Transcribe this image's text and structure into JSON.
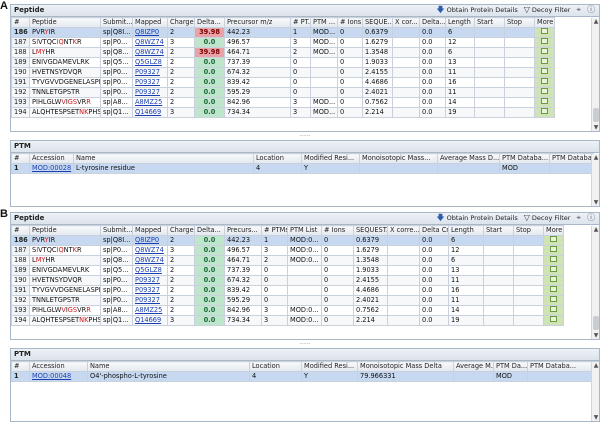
{
  "panelA": {
    "label": "A",
    "peptide": {
      "title": "Peptide",
      "obtain": "Obtain Protein Details",
      "decoy": "Decoy Filter",
      "headers": [
        "#",
        "Peptide",
        "Submit...",
        "Mapped",
        "Charge",
        "Delta...",
        "Precursor m/z",
        "# PT...",
        "PTM ...",
        "# Ions",
        "SEQUE...",
        "X cor...",
        "Delta...",
        "Length",
        "Start",
        "Stop",
        "More"
      ],
      "rows": [
        [
          "186",
          "PVRYIR",
          "sp|Q8I...",
          "Q8IZP0",
          "2",
          "39.98",
          "442.23",
          "1",
          "MOD...",
          "0",
          "0.6379",
          "",
          "0.0",
          "6",
          "",
          "",
          ""
        ],
        [
          "187",
          "SIVTQCIQNTKR",
          "sp|P0...",
          "Q8WZ74",
          "3",
          "0.0",
          "496.57",
          "3",
          "MOD...",
          "0",
          "1.6279",
          "",
          "0.0",
          "12",
          "",
          "",
          ""
        ],
        [
          "188",
          "LMYHR",
          "sp|Q8...",
          "Q8WZ74",
          "2",
          "39.98",
          "464.71",
          "2",
          "MOD...",
          "0",
          "1.3548",
          "",
          "0.0",
          "6",
          "",
          "",
          ""
        ],
        [
          "189",
          "ENIVGDAMEVLRK",
          "sp|Q5...",
          "Q5GLZ8",
          "2",
          "0.0",
          "737.39",
          "0",
          "",
          "0",
          "1.9033",
          "",
          "0.0",
          "13",
          "",
          "",
          ""
        ],
        [
          "190",
          "HVETNSYDVQR",
          "sp|P0...",
          "P09327",
          "2",
          "0.0",
          "674.32",
          "0",
          "",
          "0",
          "2.4155",
          "",
          "0.0",
          "11",
          "",
          "",
          ""
        ],
        [
          "191",
          "TYVGVVDGENELASPK",
          "sp|P0...",
          "P09327",
          "2",
          "0.0",
          "839.42",
          "0",
          "",
          "0",
          "4.4686",
          "",
          "0.0",
          "16",
          "",
          "",
          ""
        ],
        [
          "192",
          "TNNLETGPSTR",
          "sp|P0...",
          "P09327",
          "2",
          "0.0",
          "595.29",
          "0",
          "",
          "0",
          "2.4021",
          "",
          "0.0",
          "11",
          "",
          "",
          ""
        ],
        [
          "193",
          "PIHLGLWVIGSVRR",
          "sp|A8...",
          "A8MZ25",
          "2",
          "0.0",
          "842.96",
          "3",
          "MOD...",
          "0",
          "0.7562",
          "",
          "0.0",
          "14",
          "",
          "",
          ""
        ],
        [
          "194",
          "ALQHTESPSETNKPHSKS",
          "sp|Q1...",
          "Q14669",
          "3",
          "0.0",
          "734.34",
          "3",
          "MOD...",
          "0",
          "2.214",
          "",
          "0.0",
          "19",
          "",
          "",
          ""
        ]
      ]
    },
    "ptm": {
      "title": "PTM",
      "headers": [
        "#",
        "Accession",
        "Name",
        "Location",
        "Modified Resi...",
        "Monoisotopic Mass...",
        "Average Mass D...",
        "PTM Databa...",
        "PTM Database Ver..."
      ],
      "rows": [
        [
          "1",
          "MOD:00028",
          "L-tyrosine residue",
          "4",
          "Y",
          "",
          "",
          "MOD",
          ""
        ]
      ]
    }
  },
  "panelB": {
    "label": "B",
    "peptide": {
      "title": "Peptide",
      "obtain": "Obtain Protein Details",
      "decoy": "Decoy Filter",
      "headers": [
        "#",
        "Peptide",
        "Submit...",
        "Mapped",
        "Charge",
        "Delta...",
        "Precurs...",
        "# PTMs",
        "PTM List",
        "# Ions",
        "SEQUEST...",
        "X corre...",
        "Delta Cn",
        "Length",
        "Start",
        "Stop",
        "More"
      ],
      "rows": [
        [
          "186",
          "PVRYIR",
          "sp|Q8I...",
          "Q8IZP0",
          "2",
          "0.0",
          "442.23",
          "1",
          "MOD:0...",
          "0",
          "0.6379",
          "",
          "0.0",
          "6",
          "",
          "",
          ""
        ],
        [
          "187",
          "SIVTQCIQNTKR",
          "sp|P0...",
          "Q8WZ74",
          "3",
          "0.0",
          "496.57",
          "3",
          "MOD:0...",
          "0",
          "1.6279",
          "",
          "0.0",
          "12",
          "",
          "",
          ""
        ],
        [
          "188",
          "LMYHR",
          "sp|Q8...",
          "Q8WZ74",
          "2",
          "0.0",
          "464.71",
          "2",
          "MOD:0...",
          "0",
          "1.3548",
          "",
          "0.0",
          "6",
          "",
          "",
          ""
        ],
        [
          "189",
          "ENIVGDAMEVLRK",
          "sp|Q5...",
          "Q5GLZ8",
          "2",
          "0.0",
          "737.39",
          "0",
          "",
          "0",
          "1.9033",
          "",
          "0.0",
          "13",
          "",
          "",
          ""
        ],
        [
          "190",
          "HVETNSYDVQR",
          "sp|P0...",
          "P09327",
          "2",
          "0.0",
          "674.32",
          "0",
          "",
          "0",
          "2.4155",
          "",
          "0.0",
          "11",
          "",
          "",
          ""
        ],
        [
          "191",
          "TYVGVVDGENELASPK",
          "sp|P0...",
          "P09327",
          "2",
          "0.0",
          "839.42",
          "0",
          "",
          "0",
          "4.4686",
          "",
          "0.0",
          "16",
          "",
          "",
          ""
        ],
        [
          "192",
          "TNNLETGPSTR",
          "sp|P0...",
          "P09327",
          "2",
          "0.0",
          "595.29",
          "0",
          "",
          "0",
          "2.4021",
          "",
          "0.0",
          "11",
          "",
          "",
          ""
        ],
        [
          "193",
          "PIHLGLWVIGSVRR",
          "sp|A8...",
          "A8MZ25",
          "2",
          "0.0",
          "842.96",
          "3",
          "MOD:0...",
          "0",
          "0.7562",
          "",
          "0.0",
          "14",
          "",
          "",
          ""
        ],
        [
          "194",
          "ALQHTESPSETNKPHSKS",
          "sp|Q1...",
          "Q14669",
          "3",
          "0.0",
          "734.34",
          "3",
          "MOD:0...",
          "0",
          "2.214",
          "",
          "0.0",
          "19",
          "",
          "",
          ""
        ]
      ]
    },
    "ptm": {
      "title": "PTM",
      "headers": [
        "#",
        "Accession",
        "Name",
        "Location",
        "Modified Resi...",
        "Monoisotopic Mass Delta",
        "Average M...",
        "PTM Da...",
        "PTM Databa..."
      ],
      "rows": [
        [
          "1",
          "MOD:00048",
          "O4'-phospho-L-tyrosine",
          "4",
          "Y",
          "79.966331",
          "",
          "MOD",
          ""
        ]
      ]
    }
  },
  "splitter": "......",
  "icons": {
    "obtain": "down-arrow-icon",
    "decoy": "funnel-icon",
    "expand": "expand-icon",
    "help": "help-icon",
    "more": "grid-icon"
  },
  "colors": {
    "delta_positive": "#e9a2a8",
    "delta_zero": "#bfe6cc",
    "selected_row": "#c6d9f1",
    "modified_residue": "#d1191b",
    "more": "#cfe3b6"
  }
}
